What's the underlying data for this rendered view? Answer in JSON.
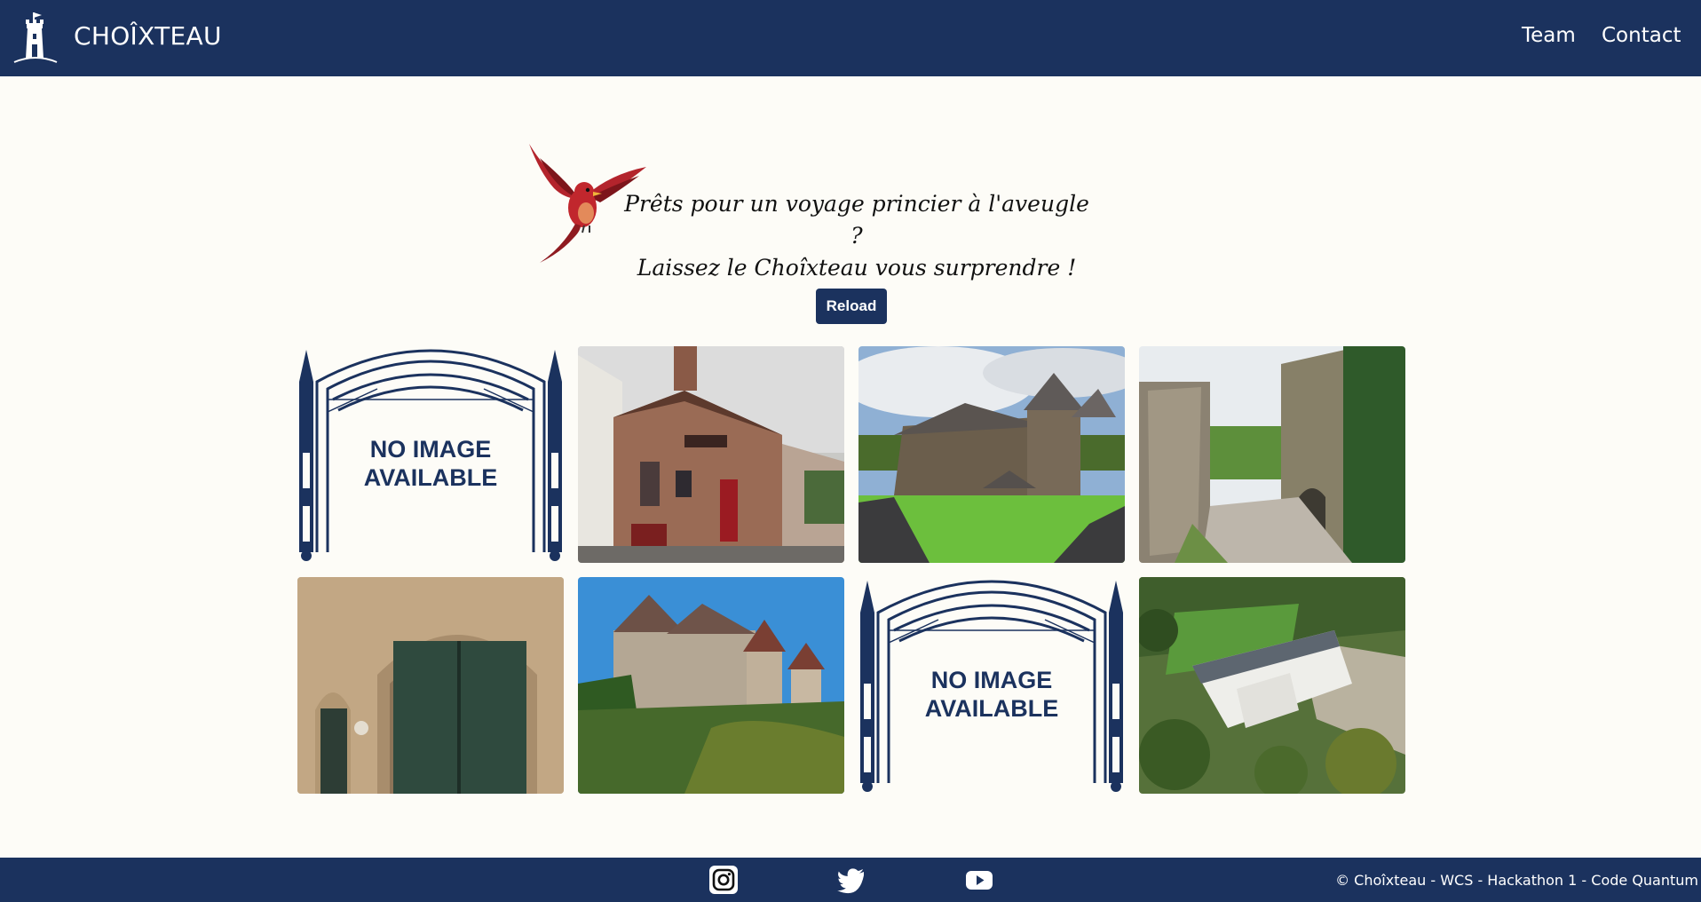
{
  "header": {
    "brand": "CHOÎXTEAU",
    "nav": {
      "team": "Team",
      "contact": "Contact"
    }
  },
  "hero": {
    "line1": "Prêts pour un voyage princier à l'aveugle ?",
    "line2": "Laissez le Choîxteau vous surprendre !",
    "reload_label": "Reload"
  },
  "gallery": {
    "placeholder_line1": "NO IMAGE",
    "placeholder_line2": "AVAILABLE",
    "items": [
      {
        "kind": "placeholder"
      },
      {
        "kind": "photo",
        "subject": "restaurant-building"
      },
      {
        "kind": "photo",
        "subject": "stone-castle-with-road"
      },
      {
        "kind": "photo",
        "subject": "ruined-towers"
      },
      {
        "kind": "photo",
        "subject": "gothic-doorway"
      },
      {
        "kind": "photo",
        "subject": "chateau-with-towers"
      },
      {
        "kind": "placeholder"
      },
      {
        "kind": "photo",
        "subject": "aerial-manor"
      }
    ]
  },
  "footer": {
    "icons": [
      "instagram-icon",
      "twitter-icon",
      "youtube-icon"
    ],
    "copyright": "© Choîxteau - WCS - Hackathon 1 - Code Quantum"
  },
  "colors": {
    "navy": "#1b325e",
    "background": "#fdfcf7"
  }
}
